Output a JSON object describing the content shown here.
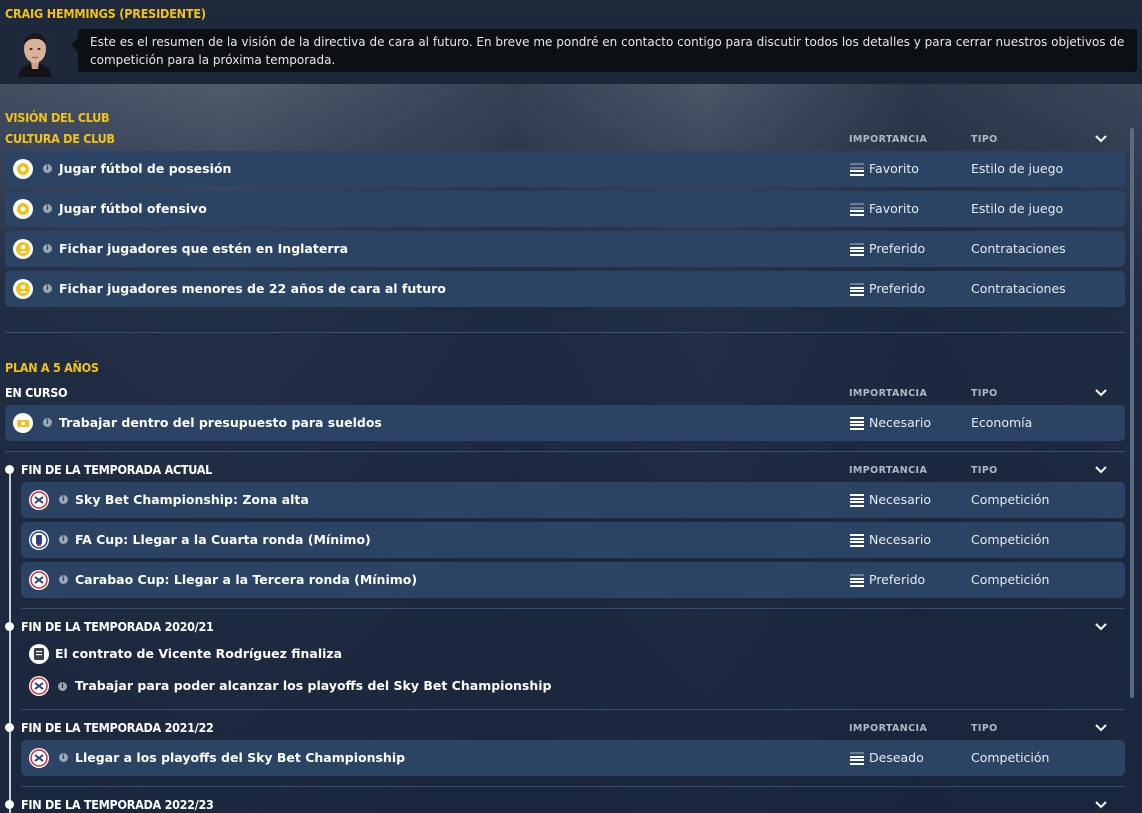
{
  "header": {
    "chairman": "CRAIG HEMMINGS (PRESIDENTE)",
    "message": "Este es el resumen de la visión de la directiva de cara al futuro. En breve me pondré en contacto contigo para discutir todos los detalles y para cerrar nuestros objetivos de competición para la próxima temporada."
  },
  "labels": {
    "importancia": "IMPORTANCIA",
    "tipo": "TIPO"
  },
  "vision": {
    "title": "VISIÓN DEL CLUB",
    "subtitle": "CULTURA DE CLUB",
    "items": [
      {
        "label": "Jugar fútbol de posesión",
        "importance": "Favorito",
        "type": "Estilo de juego",
        "icon": "tactics-icon"
      },
      {
        "label": "Jugar fútbol ofensivo",
        "importance": "Favorito",
        "type": "Estilo de juego",
        "icon": "tactics-icon"
      },
      {
        "label": "Fichar jugadores que estén en Inglaterra",
        "importance": "Preferido",
        "type": "Contrataciones",
        "icon": "player-icon"
      },
      {
        "label": "Fichar jugadores menores de 22 años de cara al futuro",
        "importance": "Preferido",
        "type": "Contrataciones",
        "icon": "player-icon"
      }
    ]
  },
  "plan": {
    "title": "PLAN A 5 AÑOS",
    "en_curso": {
      "title": "EN CURSO",
      "items": [
        {
          "label": "Trabajar dentro del presupuesto para sueldos",
          "importance": "Necesario",
          "type": "Economía",
          "icon": "money-icon"
        }
      ]
    },
    "actual": {
      "title": "FIN DE LA TEMPORADA ACTUAL",
      "items": [
        {
          "label": "Sky Bet Championship: Zona alta",
          "importance": "Necesario",
          "type": "Competición",
          "icon": "league-badge-icon"
        },
        {
          "label": "FA Cup: Llegar a la Cuarta ronda (Mínimo)",
          "importance": "Necesario",
          "type": "Competición",
          "icon": "cup-badge-icon"
        },
        {
          "label": "Carabao Cup: Llegar a la Tercera ronda (Mínimo)",
          "importance": "Preferido",
          "type": "Competición",
          "icon": "league-badge-icon"
        }
      ]
    },
    "s2021": {
      "title": "FIN DE LA TEMPORADA 2020/21",
      "items": [
        {
          "label": "El contrato de Vicente Rodríguez finaliza",
          "icon": "contract-icon"
        },
        {
          "label": "Trabajar para poder alcanzar los playoffs del Sky Bet Championship",
          "icon": "league-badge-icon"
        }
      ]
    },
    "s2122": {
      "title": "FIN DE LA TEMPORADA 2021/22",
      "items": [
        {
          "label": "Llegar a los playoffs del Sky Bet Championship",
          "importance": "Deseado",
          "type": "Competición",
          "icon": "league-badge-icon"
        }
      ]
    },
    "s2223": {
      "title": "FIN DE LA TEMPORADA 2022/23"
    }
  },
  "colors": {
    "accent": "#f2c21c",
    "row": "#2b4463",
    "header_bg": "#1e2a3c"
  }
}
